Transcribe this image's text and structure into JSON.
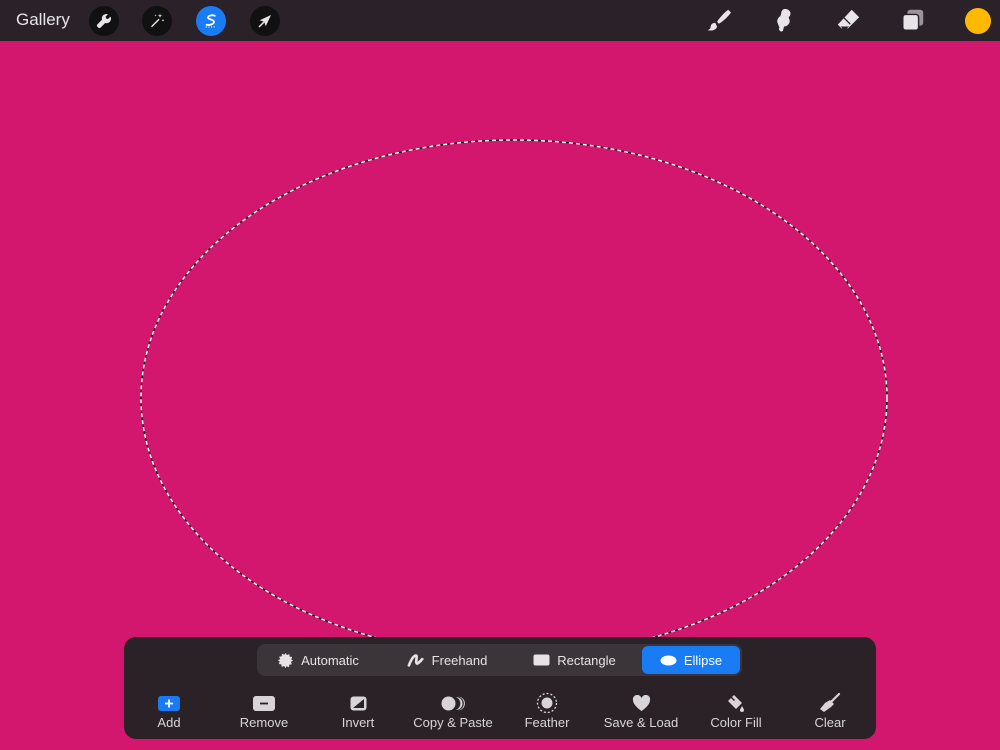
{
  "header": {
    "gallery_label": "Gallery",
    "left_tools": [
      {
        "name": "wrench-icon",
        "active": false
      },
      {
        "name": "magic-wand-icon",
        "active": false
      },
      {
        "name": "selection-icon",
        "active": true
      },
      {
        "name": "transform-arrow-icon",
        "active": false
      }
    ],
    "right_tools": [
      "brush-icon",
      "smudge-icon",
      "eraser-icon",
      "layers-icon"
    ],
    "current_color": "#ffb900"
  },
  "canvas": {
    "background_color": "#d4176e",
    "selection_shape": "ellipse"
  },
  "selection_panel": {
    "modes": [
      {
        "label": "Automatic",
        "icon": "starburst-icon",
        "active": false
      },
      {
        "label": "Freehand",
        "icon": "freehand-icon",
        "active": false
      },
      {
        "label": "Rectangle",
        "icon": "rectangle-icon",
        "active": false
      },
      {
        "label": "Ellipse",
        "icon": "ellipse-icon",
        "active": true
      }
    ],
    "actions": [
      {
        "label": "Add",
        "icon": "add-icon"
      },
      {
        "label": "Remove",
        "icon": "remove-icon"
      },
      {
        "label": "Invert",
        "icon": "invert-icon"
      },
      {
        "label": "Copy & Paste",
        "icon": "copy-paste-icon"
      },
      {
        "label": "Feather",
        "icon": "feather-icon"
      },
      {
        "label": "Save & Load",
        "icon": "heart-icon"
      },
      {
        "label": "Color Fill",
        "icon": "color-fill-icon"
      },
      {
        "label": "Clear",
        "icon": "clear-broom-icon"
      }
    ]
  },
  "colors": {
    "accent": "#1a7cf5",
    "toolbar_bg": "#2a2228",
    "panel_bg": "#2a2226"
  }
}
